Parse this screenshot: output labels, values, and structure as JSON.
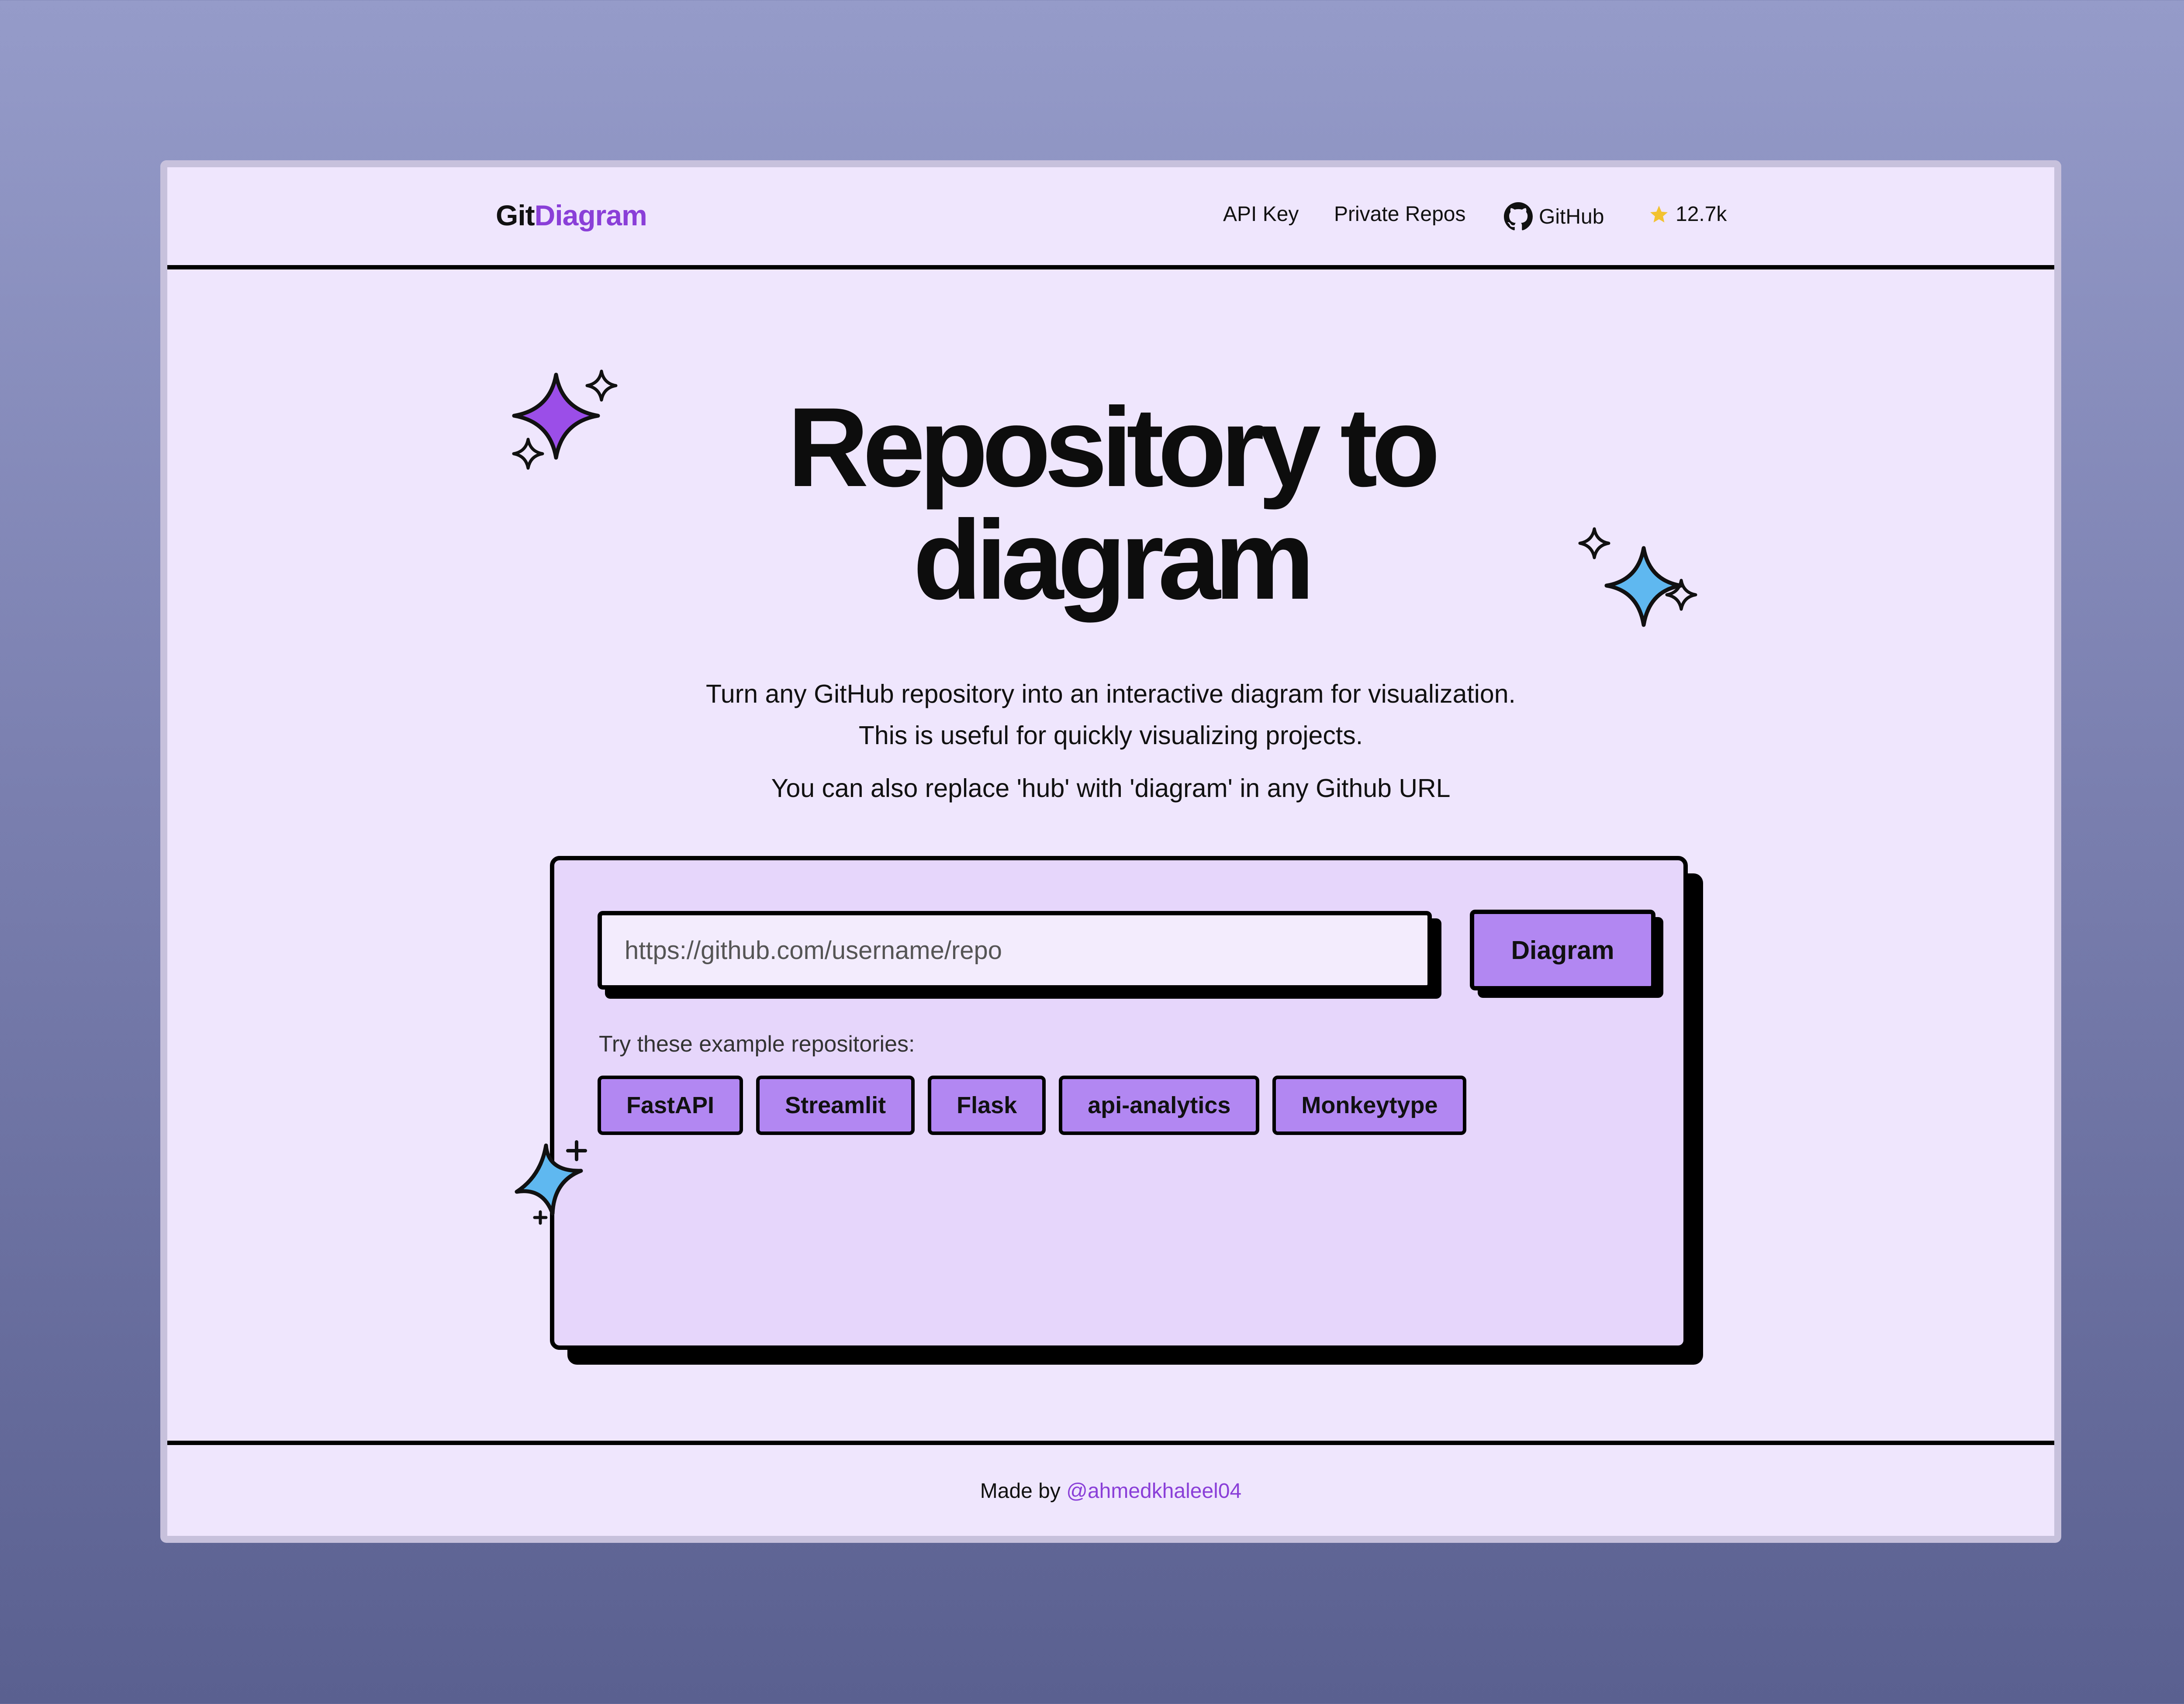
{
  "header": {
    "logo_part1": "Git",
    "logo_part2": "Diagram",
    "nav": {
      "api_key": "API Key",
      "private_repos": "Private Repos",
      "github": "GitHub",
      "stars": "12.7k"
    }
  },
  "hero": {
    "title_line1": "Repository to",
    "title_line2": "diagram",
    "subtitle_line1": "Turn any GitHub repository into an interactive diagram for visualization.",
    "subtitle_line2": "This is useful for quickly visualizing projects.",
    "subtitle_line3": "You can also replace 'hub' with 'diagram' in any Github URL"
  },
  "form": {
    "url_placeholder": "https://github.com/username/repo",
    "url_value": "",
    "submit_label": "Diagram",
    "examples_label": "Try these example repositories:",
    "examples": [
      "FastAPI",
      "Streamlit",
      "Flask",
      "api-analytics",
      "Monkeytype"
    ]
  },
  "footer": {
    "made_by": "Made by",
    "author": "@ahmedkhaleel04"
  },
  "colors": {
    "accent_purple": "#8a3fd8",
    "button_purple": "#b287f2",
    "page_bg": "#efe6fd",
    "card_bg": "#e6d6fb",
    "sparkle_blue": "#5fb8f0",
    "sparkle_purple": "#9b4ee8",
    "star_yellow": "#f2c230"
  },
  "icons": [
    "github-icon",
    "star-icon",
    "sparkle-icon"
  ]
}
